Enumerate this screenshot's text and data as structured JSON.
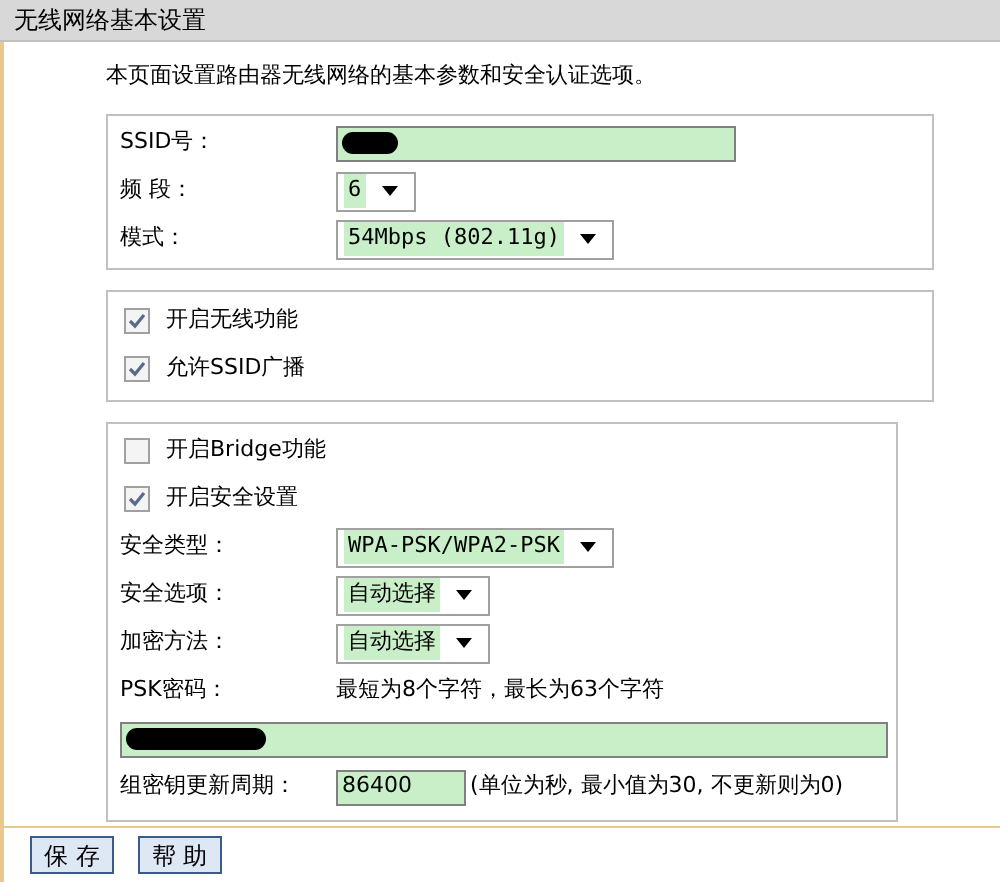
{
  "title": "无线网络基本设置",
  "intro": "本页面设置路由器无线网络的基本参数和安全认证选项。",
  "basic": [
    {
      "kind": "text",
      "label": "SSID号：",
      "redacted": true
    },
    {
      "kind": "select",
      "label": "频 段：",
      "value": "6"
    },
    {
      "kind": "select",
      "label": "模式：",
      "value": "54Mbps (802.11g)"
    }
  ],
  "switches": [
    {
      "label": "开启无线功能",
      "checked": true
    },
    {
      "label": "允许SSID广播",
      "checked": true
    }
  ],
  "security": {
    "toggles": [
      {
        "label": "开启Bridge功能",
        "checked": false
      },
      {
        "label": "开启安全设置",
        "checked": true
      }
    ],
    "rows": [
      {
        "kind": "select",
        "label": "安全类型：",
        "value": "WPA-PSK/WPA2-PSK"
      },
      {
        "kind": "select",
        "label": "安全选项：",
        "value": "自动选择"
      },
      {
        "kind": "select",
        "label": "加密方法：",
        "value": "自动选择"
      },
      {
        "kind": "note",
        "label": "PSK密码：",
        "note": "最短为8个字符，最长为63个字符"
      },
      {
        "kind": "wide",
        "redacted": true
      },
      {
        "kind": "text",
        "label": "组密钥更新周期：",
        "value": "86400",
        "note": "(单位为秒, 最小值为30, 不更新则为0)"
      }
    ]
  },
  "buttons": [
    "保 存",
    "帮 助"
  ]
}
